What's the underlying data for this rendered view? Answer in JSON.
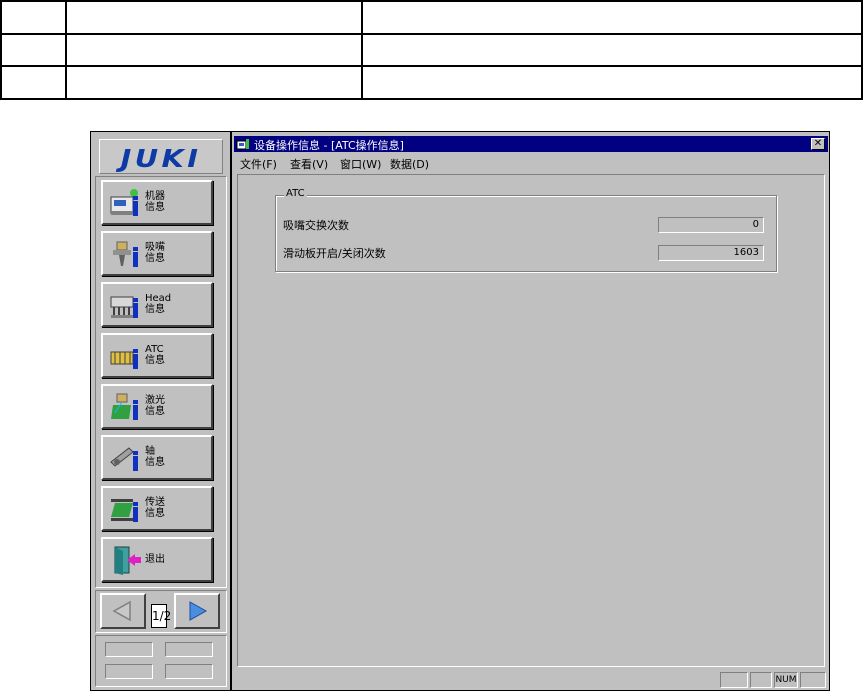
{
  "window": {
    "title": "设备操作信息 - [ATC操作信息]",
    "close_glyph": "✕"
  },
  "menubar": [
    "文件(F)",
    "查看(V)",
    "窗口(W)",
    "数据(D)"
  ],
  "logo": "JUKI",
  "sidebar": {
    "items": [
      {
        "label": "机器\n信息",
        "icon": "machine-info-icon"
      },
      {
        "label": "吸嘴\n信息",
        "icon": "nozzle-info-icon"
      },
      {
        "label": "Head\n信息",
        "icon": "head-info-icon"
      },
      {
        "label": "ATC\n信息",
        "icon": "atc-info-icon"
      },
      {
        "label": "激光\n信息",
        "icon": "laser-info-icon"
      },
      {
        "label": "轴\n信息",
        "icon": "axis-info-icon"
      },
      {
        "label": "传送\n信息",
        "icon": "conveyor-info-icon"
      },
      {
        "label": "退出",
        "icon": "exit-door-icon"
      }
    ],
    "pager": {
      "prev_icon": "arrow-left-icon",
      "next_icon": "arrow-right-icon",
      "page": "1/2"
    }
  },
  "atc_group": {
    "title": "ATC",
    "rows": [
      {
        "label": "吸嘴交换次数",
        "value": "0"
      },
      {
        "label": "滑动板开启/关闭次数",
        "value": "1603"
      }
    ]
  },
  "statusbar": {
    "num": "NUM"
  },
  "colors": {
    "titlebar": "#000080",
    "face": "#c0c0c0",
    "logo": "#0e3aa6"
  }
}
